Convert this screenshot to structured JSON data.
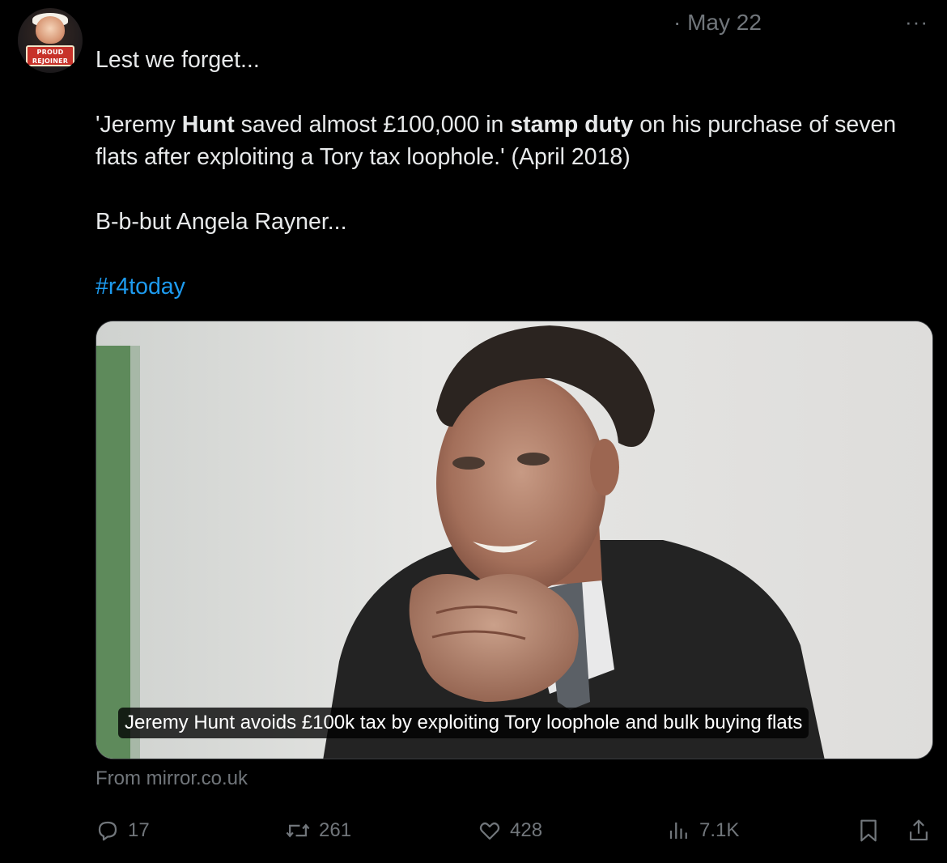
{
  "author": {
    "avatar_text": "PROUD REJOINER"
  },
  "date": "· May 22",
  "more_label": "···",
  "tweet": {
    "line1": "Lest we forget...",
    "quote_open": "'Jeremy ",
    "quote_bold1": "Hunt",
    "quote_mid": " saved almost £100,000 in ",
    "quote_bold2": "stamp duty",
    "quote_end": " on his purchase of seven flats after exploiting a Tory tax loophole.' (April 2018)",
    "line3": "B-b-but Angela Rayner...",
    "hashtag": "#r4today"
  },
  "media": {
    "caption": "Jeremy Hunt avoids £100k tax by exploiting Tory loophole and bulk buying flats"
  },
  "source": "From mirror.co.uk",
  "actions": {
    "replies": "17",
    "reposts": "261",
    "likes": "428",
    "views": "7.1K"
  },
  "icons": [
    "reply-icon",
    "repost-icon",
    "like-icon",
    "views-icon",
    "bookmark-icon",
    "share-icon"
  ],
  "colors": {
    "background": "#000000",
    "text": "#e7e9ea",
    "muted": "#71767b",
    "link": "#1d9bf0"
  }
}
